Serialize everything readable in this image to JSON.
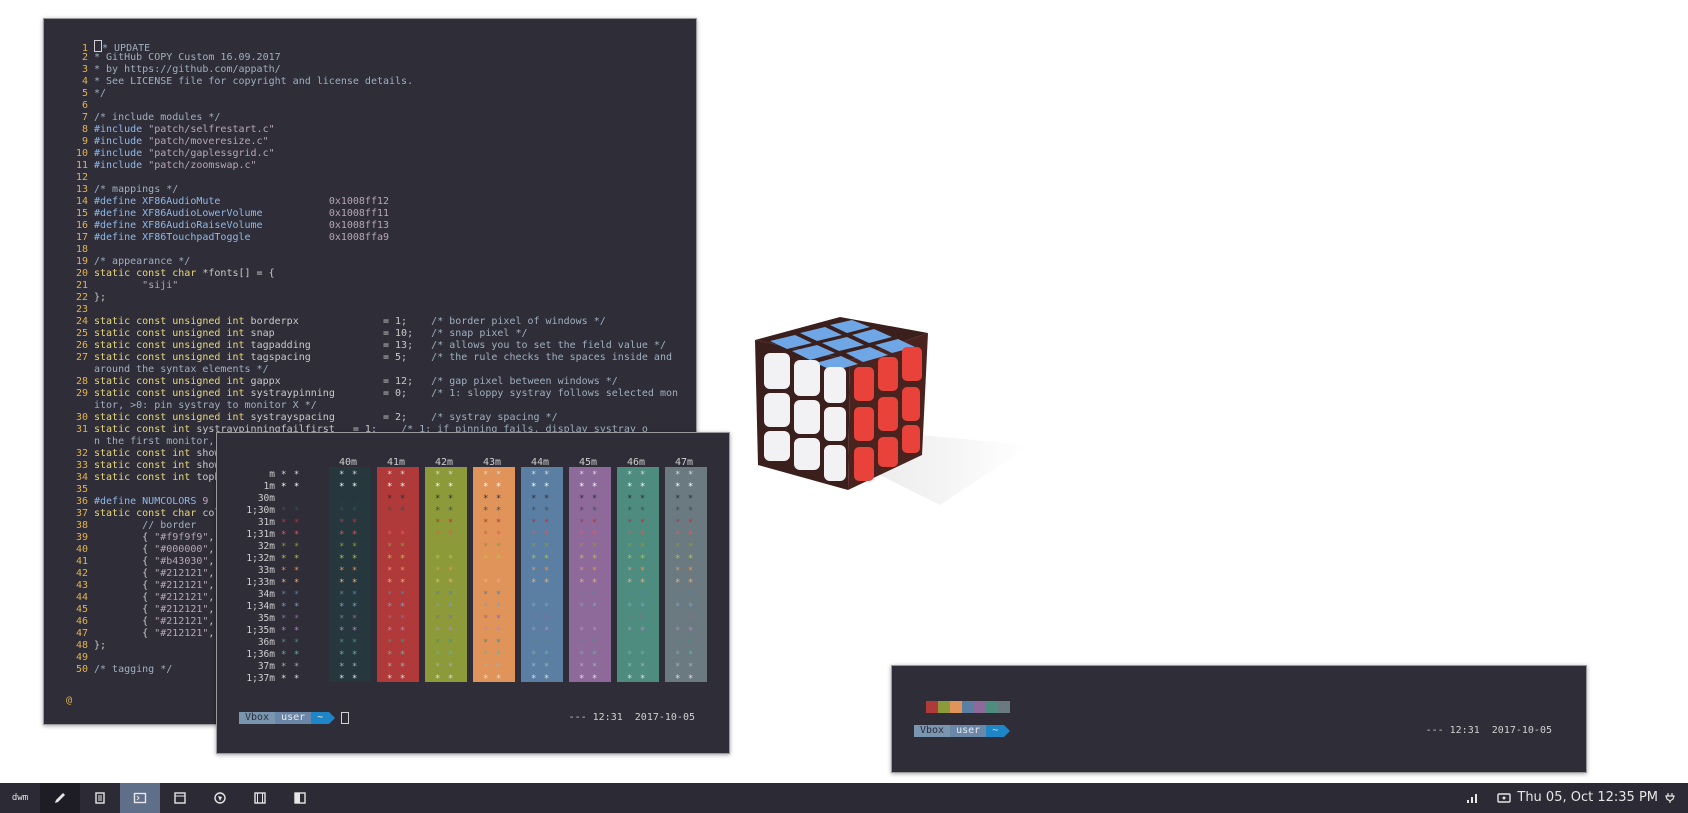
{
  "editor": {
    "lines": [
      {
        "n": "1",
        "parts": [
          [
            "cursor",
            ""
          ],
          [
            "cm",
            "* UPDATE"
          ]
        ]
      },
      {
        "n": "2",
        "parts": [
          [
            "cm",
            "* GitHub COPY Custom 16.09.2017"
          ]
        ]
      },
      {
        "n": "3",
        "parts": [
          [
            "cm",
            "* by https://github.com/appath/"
          ]
        ]
      },
      {
        "n": "4",
        "parts": [
          [
            "cm",
            "* See LICENSE file for copyright and license details."
          ]
        ]
      },
      {
        "n": "5",
        "parts": [
          [
            "cm",
            "*/"
          ]
        ]
      },
      {
        "n": "6",
        "parts": []
      },
      {
        "n": "7",
        "parts": [
          [
            "cm",
            "/* include modules */"
          ]
        ]
      },
      {
        "n": "8",
        "parts": [
          [
            "pp",
            "#include "
          ],
          [
            "st",
            "\"patch/selfrestart.c\""
          ]
        ]
      },
      {
        "n": "9",
        "parts": [
          [
            "pp",
            "#include "
          ],
          [
            "st",
            "\"patch/moveresize.c\""
          ]
        ]
      },
      {
        "n": "10",
        "parts": [
          [
            "pp",
            "#include "
          ],
          [
            "st",
            "\"patch/gaplessgrid.c\""
          ]
        ]
      },
      {
        "n": "11",
        "parts": [
          [
            "pp",
            "#include "
          ],
          [
            "st",
            "\"patch/zoomswap.c\""
          ]
        ]
      },
      {
        "n": "12",
        "parts": []
      },
      {
        "n": "13",
        "parts": [
          [
            "cm",
            "/* mappings */"
          ]
        ]
      },
      {
        "n": "14",
        "parts": [
          [
            "pp",
            "#define XF86AudioMute                  "
          ],
          [
            "st",
            "0x1008ff12"
          ]
        ]
      },
      {
        "n": "15",
        "parts": [
          [
            "pp",
            "#define XF86AudioLowerVolume           "
          ],
          [
            "st",
            "0x1008ff11"
          ]
        ]
      },
      {
        "n": "16",
        "parts": [
          [
            "pp",
            "#define XF86AudioRaiseVolume           "
          ],
          [
            "st",
            "0x1008ff13"
          ]
        ]
      },
      {
        "n": "17",
        "parts": [
          [
            "pp",
            "#define XF86TouchpadToggle             "
          ],
          [
            "st",
            "0x1008ffa9"
          ]
        ]
      },
      {
        "n": "18",
        "parts": []
      },
      {
        "n": "19",
        "parts": [
          [
            "cm",
            "/* appearance */"
          ]
        ]
      },
      {
        "n": "20",
        "parts": [
          [
            "kw",
            "static const char "
          ],
          [
            "tx",
            "*fonts[] = {"
          ]
        ]
      },
      {
        "n": "21",
        "parts": [
          [
            "tx",
            "        "
          ],
          [
            "st",
            "\"siji\""
          ]
        ]
      },
      {
        "n": "22",
        "parts": [
          [
            "tx",
            "};"
          ]
        ]
      },
      {
        "n": "23",
        "parts": []
      },
      {
        "n": "24",
        "parts": [
          [
            "kw",
            "static const unsigned int "
          ],
          [
            "tx",
            "borderpx              = 1;    "
          ],
          [
            "cm",
            "/* border pixel of windows */"
          ]
        ]
      },
      {
        "n": "25",
        "parts": [
          [
            "kw",
            "static const unsigned int "
          ],
          [
            "tx",
            "snap                  = 10;   "
          ],
          [
            "cm",
            "/* snap pixel */"
          ]
        ]
      },
      {
        "n": "26",
        "parts": [
          [
            "kw",
            "static const unsigned int "
          ],
          [
            "tx",
            "tagpadding            = 13;   "
          ],
          [
            "cm",
            "/* allows you to set the field value */"
          ]
        ]
      },
      {
        "n": "27",
        "parts": [
          [
            "kw",
            "static const unsigned int "
          ],
          [
            "tx",
            "tagspacing            = 5;    "
          ],
          [
            "cm",
            "/* the rule checks the spaces inside and"
          ]
        ]
      },
      {
        "n": "",
        "parts": [
          [
            "cm",
            "around the syntax elements */"
          ]
        ]
      },
      {
        "n": "28",
        "parts": [
          [
            "kw",
            "static const unsigned int "
          ],
          [
            "tx",
            "gappx                 = 12;   "
          ],
          [
            "cm",
            "/* gap pixel between windows */"
          ]
        ]
      },
      {
        "n": "29",
        "parts": [
          [
            "kw",
            "static const unsigned int "
          ],
          [
            "tx",
            "systraypinning        = 0;    "
          ],
          [
            "cm",
            "/* 1: sloppy systray follows selected mon"
          ]
        ]
      },
      {
        "n": "",
        "parts": [
          [
            "cm",
            "itor, >0: pin systray to monitor X */"
          ]
        ]
      },
      {
        "n": "30",
        "parts": [
          [
            "kw",
            "static const unsigned int "
          ],
          [
            "tx",
            "systrayspacing        = 2;    "
          ],
          [
            "cm",
            "/* systray spacing */"
          ]
        ]
      },
      {
        "n": "31",
        "parts": [
          [
            "kw",
            "static const int "
          ],
          [
            "tx",
            "systraypinningfailfirst   = 1;    "
          ],
          [
            "cm",
            "/* 1: if pinning fails, display systray o"
          ]
        ]
      },
      {
        "n": "",
        "parts": [
          [
            "cm",
            "n the first monitor,"
          ]
        ]
      },
      {
        "n": "32",
        "parts": [
          [
            "kw",
            "static const int "
          ],
          [
            "tx",
            "show"
          ]
        ]
      },
      {
        "n": "33",
        "parts": [
          [
            "kw",
            "static const int "
          ],
          [
            "tx",
            "show"
          ]
        ]
      },
      {
        "n": "34",
        "parts": [
          [
            "kw",
            "static const int "
          ],
          [
            "tx",
            "topb"
          ]
        ]
      },
      {
        "n": "35",
        "parts": []
      },
      {
        "n": "36",
        "parts": [
          [
            "pp",
            "#define NUMCOLORS "
          ],
          [
            "st",
            "9"
          ]
        ]
      },
      {
        "n": "37",
        "parts": [
          [
            "kw",
            "static const char "
          ],
          [
            "tx",
            "col"
          ]
        ]
      },
      {
        "n": "38",
        "parts": [
          [
            "tx",
            "        "
          ],
          [
            "cm",
            "// border"
          ]
        ]
      },
      {
        "n": "39",
        "parts": [
          [
            "tx",
            "        { "
          ],
          [
            "st",
            "\"#f9f9f9\""
          ],
          [
            "tx",
            ","
          ]
        ]
      },
      {
        "n": "40",
        "parts": [
          [
            "tx",
            "        { "
          ],
          [
            "st",
            "\"#000000\""
          ],
          [
            "tx",
            ","
          ]
        ]
      },
      {
        "n": "41",
        "parts": [
          [
            "tx",
            "        { "
          ],
          [
            "st",
            "\"#b43030\""
          ],
          [
            "tx",
            ","
          ]
        ]
      },
      {
        "n": "42",
        "parts": [
          [
            "tx",
            "        { "
          ],
          [
            "st",
            "\"#212121\""
          ],
          [
            "tx",
            ","
          ]
        ]
      },
      {
        "n": "43",
        "parts": [
          [
            "tx",
            "        { "
          ],
          [
            "st",
            "\"#212121\""
          ],
          [
            "tx",
            ","
          ]
        ]
      },
      {
        "n": "44",
        "parts": [
          [
            "tx",
            "        { "
          ],
          [
            "st",
            "\"#212121\""
          ],
          [
            "tx",
            ","
          ]
        ]
      },
      {
        "n": "45",
        "parts": [
          [
            "tx",
            "        { "
          ],
          [
            "st",
            "\"#212121\""
          ],
          [
            "tx",
            ","
          ]
        ]
      },
      {
        "n": "46",
        "parts": [
          [
            "tx",
            "        { "
          ],
          [
            "st",
            "\"#212121\""
          ],
          [
            "tx",
            ","
          ]
        ]
      },
      {
        "n": "47",
        "parts": [
          [
            "tx",
            "        { "
          ],
          [
            "st",
            "\"#212121\""
          ],
          [
            "tx",
            ","
          ]
        ]
      },
      {
        "n": "48",
        "parts": [
          [
            "tx",
            "};"
          ]
        ]
      },
      {
        "n": "49",
        "parts": []
      },
      {
        "n": "50",
        "parts": [
          [
            "cm",
            "/* tagging */"
          ]
        ]
      }
    ],
    "tilde": "@"
  },
  "colorterm": {
    "headers": [
      "40m",
      "41m",
      "42m",
      "43m",
      "44m",
      "45m",
      "46m",
      "47m"
    ],
    "bands": [
      "#26383e",
      "#b03a3a",
      "#8c9a3a",
      "#e0945a",
      "#5a7fa3",
      "#8e6a9a",
      "#4e8c80",
      "#6b7a80"
    ],
    "rows": [
      "m",
      "1m",
      "30m",
      "1;30m",
      "31m",
      "1;31m",
      "32m",
      "1;32m",
      "33m",
      "1;33m",
      "34m",
      "1;34m",
      "35m",
      "1;35m",
      "36m",
      "1;36m",
      "37m",
      "1;37m"
    ],
    "row_colors": [
      "#d8d8d8",
      "#ffffff",
      "#2e2d38",
      "#3b4f55",
      "#b03a3a",
      "#e05a5a",
      "#8c9a3a",
      "#b4c44a",
      "#e0945a",
      "#f0b07a",
      "#5a7fa3",
      "#7aa0c8",
      "#8e6a9a",
      "#b08ac0",
      "#4e8c80",
      "#6ab0a0",
      "#a0b0b8",
      "#e0e0e0"
    ],
    "star": "* *",
    "prompt": {
      "host": "Vbox",
      "user": "user",
      "dir": "~"
    },
    "clock": "--- 12:31  2017-10-05"
  },
  "smallterm": {
    "swatches": [
      "#2e2d38",
      "#b03a3a",
      "#8c9a3a",
      "#e0945a",
      "#5a7fa3",
      "#8e6a9a",
      "#4e8c80",
      "#6b7a80"
    ],
    "prompt": {
      "host": "Vbox",
      "user": "user",
      "dir": "~"
    },
    "clock": "--- 12:31  2017-10-05"
  },
  "taskbar": {
    "logo": "dwm",
    "clock": "Thu 05, Oct 12:35 PM"
  }
}
